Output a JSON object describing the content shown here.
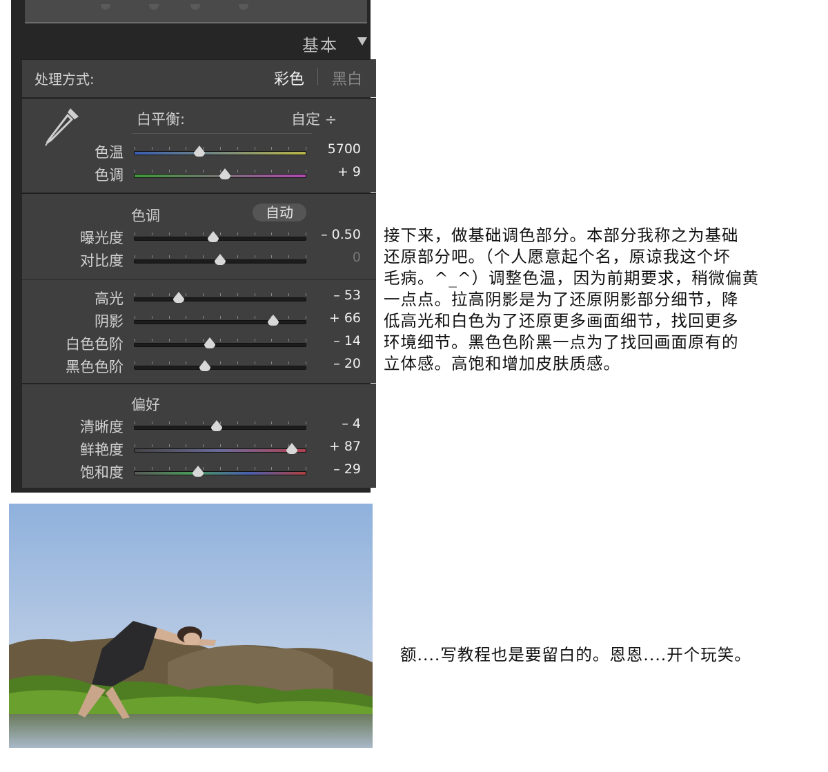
{
  "panel": {
    "header_title": "基本",
    "treatment": {
      "label": "处理方式:",
      "color": "彩色",
      "bw": "黑白"
    },
    "white_balance": {
      "label": "白平衡:",
      "value": "自定 ÷"
    },
    "tone": {
      "title": "色调",
      "auto": "自动"
    },
    "presence": {
      "title": "偏好"
    },
    "sliders": {
      "wb": [
        {
          "label": "色温",
          "value": "5700",
          "pos": 0.38
        },
        {
          "label": "色调",
          "value": "+ 9",
          "pos": 0.53
        }
      ],
      "tone1": [
        {
          "label": "曝光度",
          "value": "– 0.50",
          "pos": 0.46
        },
        {
          "label": "对比度",
          "value": "0",
          "pos": 0.5,
          "dim": true
        }
      ],
      "tone2": [
        {
          "label": "高光",
          "value": "– 53",
          "pos": 0.26
        },
        {
          "label": "阴影",
          "value": "+ 66",
          "pos": 0.81
        },
        {
          "label": "白色色阶",
          "value": "– 14",
          "pos": 0.44
        },
        {
          "label": "黑色色阶",
          "value": "– 20",
          "pos": 0.41
        }
      ],
      "presence": [
        {
          "label": "清晰度",
          "value": "– 4",
          "pos": 0.48
        },
        {
          "label": "鲜艳度",
          "value": "+ 87",
          "pos": 0.92
        },
        {
          "label": "饱和度",
          "value": "– 29",
          "pos": 0.37
        }
      ]
    },
    "colors": {
      "panel_bg": "#3f3f3f",
      "thumb": "#d8d8d8"
    }
  },
  "article": {
    "paragraph": "接下来，做基础调色部分。本部分我称之为基础\n还原部分吧。（个人愿意起个名，原谅我这个坏\n毛病。^_^）调整色温，因为前期要求，稍微偏黄\n一点点。拉高阴影是为了还原阴影部分细节，降\n低高光和白色为了还原更多画面细节，找回更多\n环境细节。黑色色阶黑一点为了找回画面原有的\n立体感。高饱和增加皮肤质感。",
    "caption": "额....写教程也是要留白的。恩恩....开个玩笑。"
  }
}
